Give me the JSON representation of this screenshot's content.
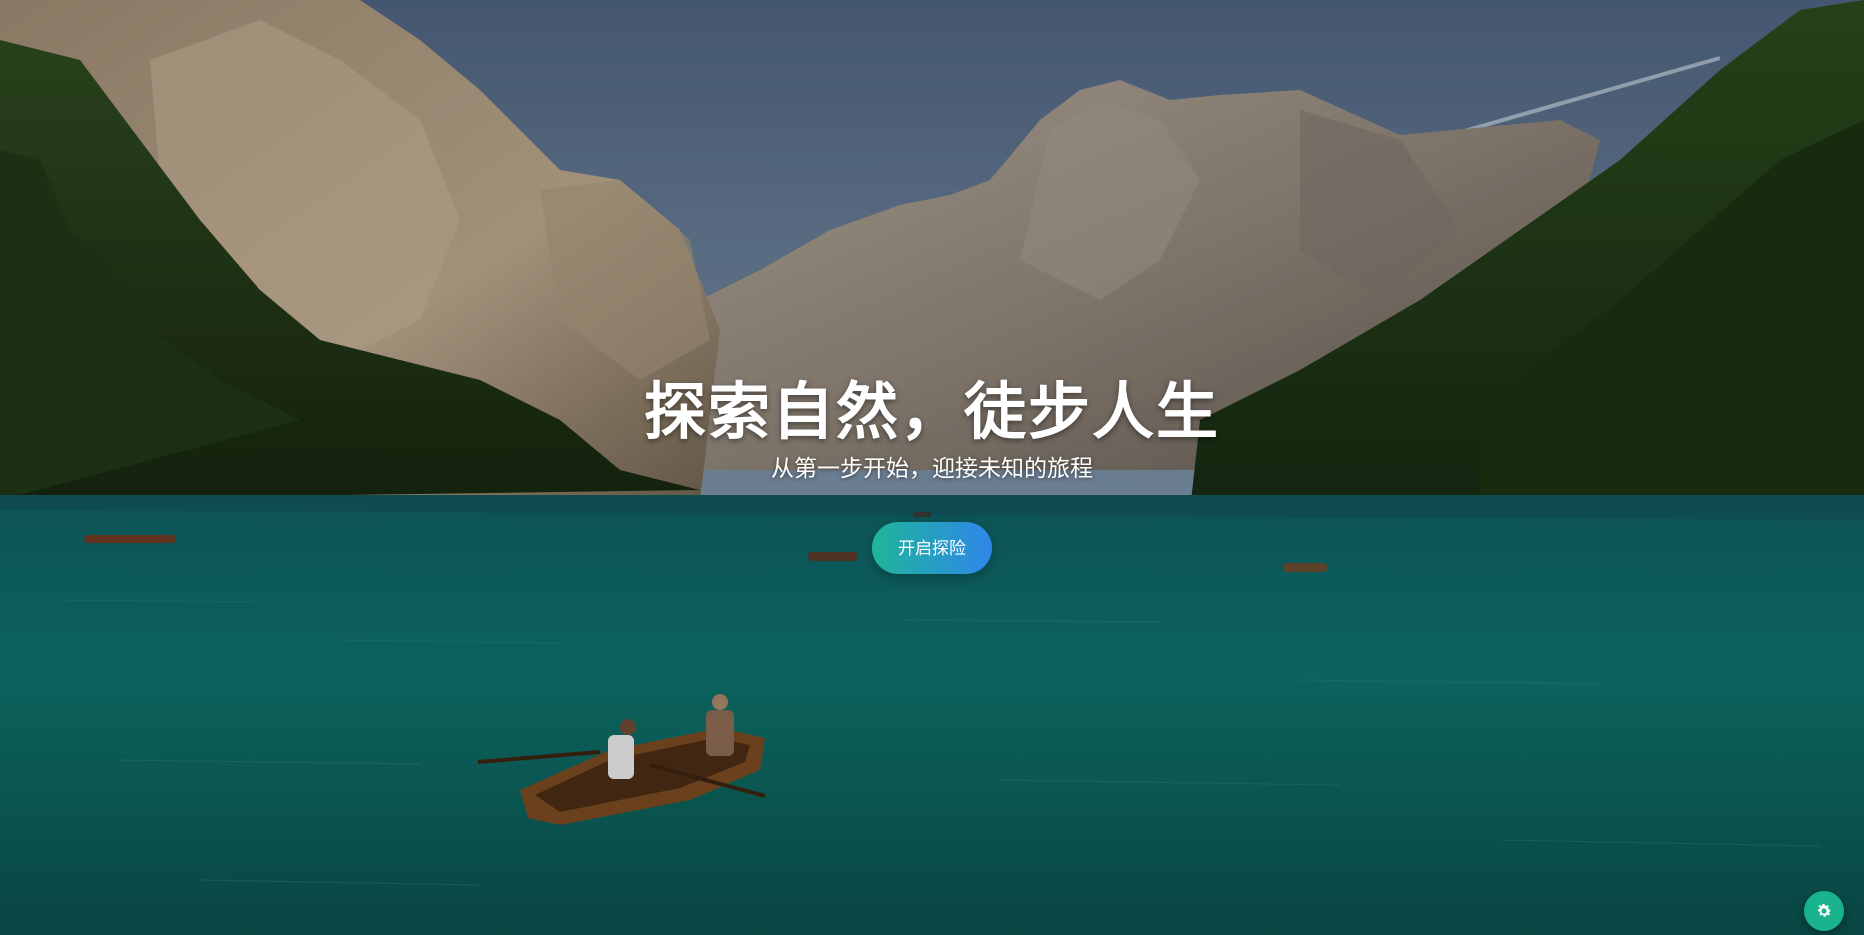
{
  "hero": {
    "title": "探索自然，徒步人生",
    "subtitle": "从第一步开始，迎接未知的旅程",
    "cta_label": "开启探险"
  },
  "settings_button": {
    "icon": "gear-icon"
  },
  "colors": {
    "cta_gradient_start": "#1fb59a",
    "cta_gradient_end": "#2f86ea",
    "settings_button": "#19b38e",
    "lake": "#0f6d66",
    "sky": "#5d7590"
  }
}
